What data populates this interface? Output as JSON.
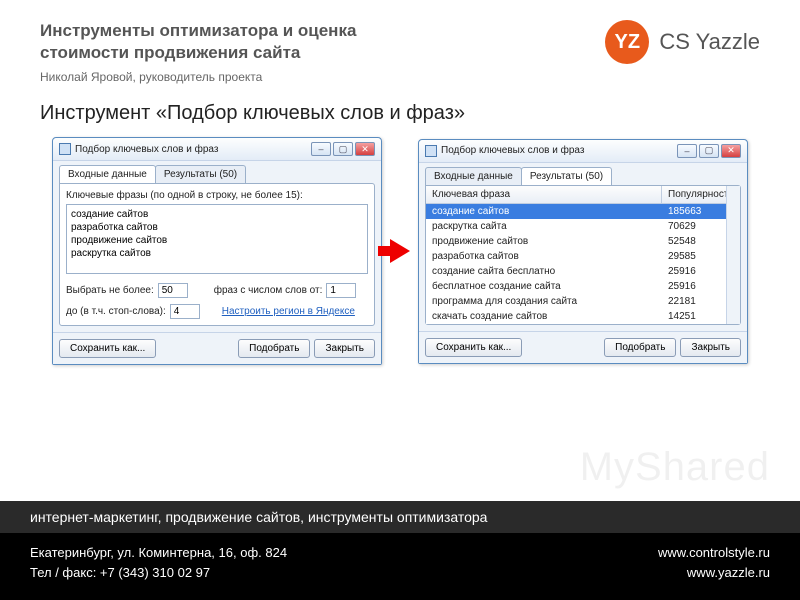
{
  "header": {
    "title_l1": "Инструменты оптимизатора и оценка",
    "title_l2": "стоимости продвижения сайта",
    "subtitle": "Николай Яровой, руководитель проекта",
    "logo_text": "CS Yazzle",
    "logo_badge": "YZ"
  },
  "section_title": "Инструмент «Подбор ключевых слов и фраз»",
  "dialog": {
    "title": "Подбор ключевых слов и фраз",
    "tab_input": "Входные данные",
    "tab_results": "Результаты (50)",
    "input_label": "Ключевые фразы (по одной в строку, не более 15):",
    "textarea_value": "создание сайтов\nразработка сайтов\nпродвижение сайтов\nраскрутка сайтов",
    "select_max_lbl": "Выбрать не более:",
    "select_max_val": "50",
    "words_from_lbl": "фраз с числом слов от:",
    "words_from_val": "1",
    "words_to_lbl": "до (в т.ч. стоп-слова):",
    "words_to_val": "4",
    "region_link": "Настроить регион в Яндексе",
    "col_phrase": "Ключевая фраза",
    "col_pop": "Популярность",
    "rows": [
      {
        "phrase": "создание сайтов",
        "pop": "185663",
        "sel": true
      },
      {
        "phrase": "раскрутка сайта",
        "pop": "70629"
      },
      {
        "phrase": "продвижение сайтов",
        "pop": "52548"
      },
      {
        "phrase": "разработка сайтов",
        "pop": "29585"
      },
      {
        "phrase": "создание сайта бесплатно",
        "pop": "25916"
      },
      {
        "phrase": "бесплатное создание сайта",
        "pop": "25916"
      },
      {
        "phrase": "программа для создания сайта",
        "pop": "22181"
      },
      {
        "phrase": "скачать создание сайтов",
        "pop": "14251"
      }
    ],
    "btn_save": "Сохранить как...",
    "btn_pick": "Подобрать",
    "btn_close": "Закрыть"
  },
  "footer": {
    "tagline": "интернет-маркетинг, продвижение сайтов, инструменты оптимизатора",
    "addr": "Екатеринбург, ул. Коминтерна, 16, оф. 824",
    "phone": "Тел / факс: +7 (343) 310 02 97",
    "url1": "www.controlstyle.ru",
    "url2": "www.yazzle.ru"
  },
  "watermark": "MyShared"
}
